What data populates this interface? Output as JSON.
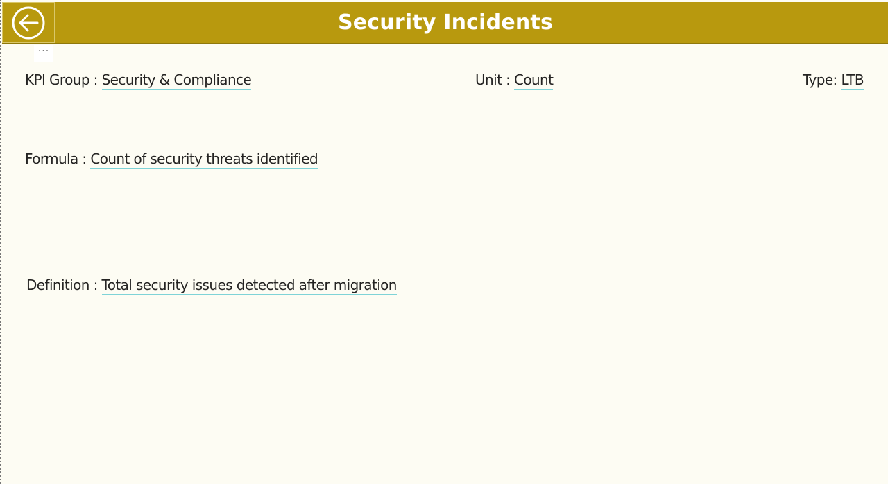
{
  "header": {
    "title": "Security Incidents",
    "back_icon": "back-arrow-circle-icon",
    "more_label": "···"
  },
  "fields": {
    "kpi_group": {
      "label": "KPI Group : ",
      "value": "Security & Compliance"
    },
    "unit": {
      "label": "Unit : ",
      "value": "Count"
    },
    "type": {
      "label": "Type: ",
      "value": "LTB"
    },
    "formula": {
      "label": "Formula : ",
      "value": "Count of security threats identified"
    },
    "definition": {
      "label": "Definition : ",
      "value": "Total security issues detected after migration"
    }
  },
  "colors": {
    "header_bg": "#b8990e",
    "page_bg": "#fdfcf3",
    "value_underline": "#7fd3d7"
  }
}
